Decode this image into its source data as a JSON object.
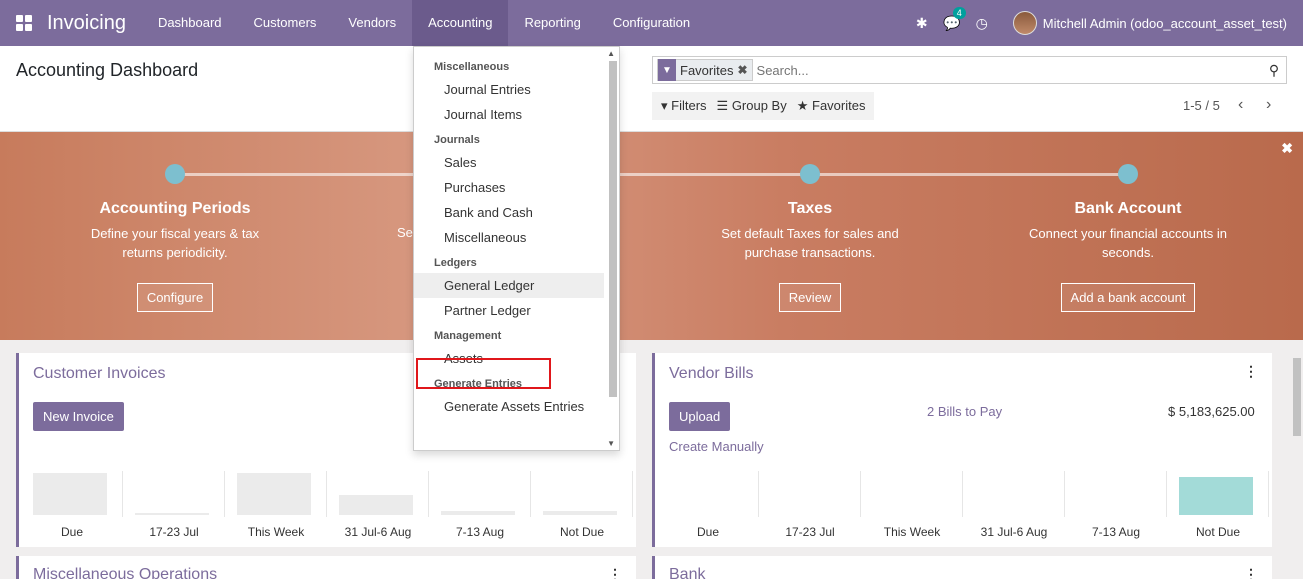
{
  "navbar": {
    "app_name": "Invoicing",
    "menu": [
      "Dashboard",
      "Customers",
      "Vendors",
      "Accounting",
      "Reporting",
      "Configuration"
    ],
    "active_menu": "Accounting",
    "chat_badge": "4",
    "user": "Mitchell Admin (odoo_account_asset_test)"
  },
  "control_panel": {
    "title": "Accounting Dashboard",
    "facet_label": "Favorites",
    "search_placeholder": "Search...",
    "filters_label": "Filters",
    "group_by_label": "Group By",
    "favorites_label": "Favorites",
    "pager": "1-5 / 5"
  },
  "banner": {
    "steps": [
      {
        "title": "Accounting Periods",
        "desc1": "Define your fiscal years & tax",
        "desc2": "returns periodicity.",
        "button": "Configure"
      },
      {
        "title": "Taxes",
        "desc1": "Set default Taxes for sales and",
        "desc2": "purchase transactions.",
        "button": "Review"
      },
      {
        "title": "Bank Account",
        "desc1": "Connect your financial accounts in",
        "desc2": "seconds.",
        "button": "Add a bank account"
      }
    ],
    "partial_text": "Se"
  },
  "cards": {
    "customer_invoices": {
      "title": "Customer Invoices",
      "button": "New Invoice"
    },
    "vendor_bills": {
      "title": "Vendor Bills",
      "button": "Upload",
      "link": "Create Manually",
      "bills_to_pay": "2 Bills to Pay",
      "amount": "$ 5,183,625.00"
    },
    "misc_operations": {
      "title": "Miscellaneous Operations"
    },
    "bank": {
      "title": "Bank"
    }
  },
  "graph_labels": [
    "Due",
    "17-23 Jul",
    "This Week",
    "31 Jul-6 Aug",
    "7-13 Aug",
    "Not Due"
  ],
  "customer_graph_values": [
    42,
    2,
    42,
    20,
    4,
    4
  ],
  "vendor_graph_values": [
    0,
    0,
    0,
    0,
    0,
    38
  ],
  "dropdown": {
    "sections": [
      {
        "header": "Miscellaneous",
        "items": [
          "Journal Entries",
          "Journal Items"
        ]
      },
      {
        "header": "Journals",
        "items": [
          "Sales",
          "Purchases",
          "Bank and Cash",
          "Miscellaneous"
        ]
      },
      {
        "header": "Ledgers",
        "items": [
          "General Ledger",
          "Partner Ledger"
        ]
      },
      {
        "header": "Management",
        "items": [
          "Assets"
        ]
      },
      {
        "header": "Generate Entries",
        "items": [
          "Generate Assets Entries"
        ]
      }
    ]
  },
  "colors": {
    "brand": "#7c6c9c",
    "highlight": "#e0171b",
    "vendor_bar": "#a3dbd8"
  }
}
